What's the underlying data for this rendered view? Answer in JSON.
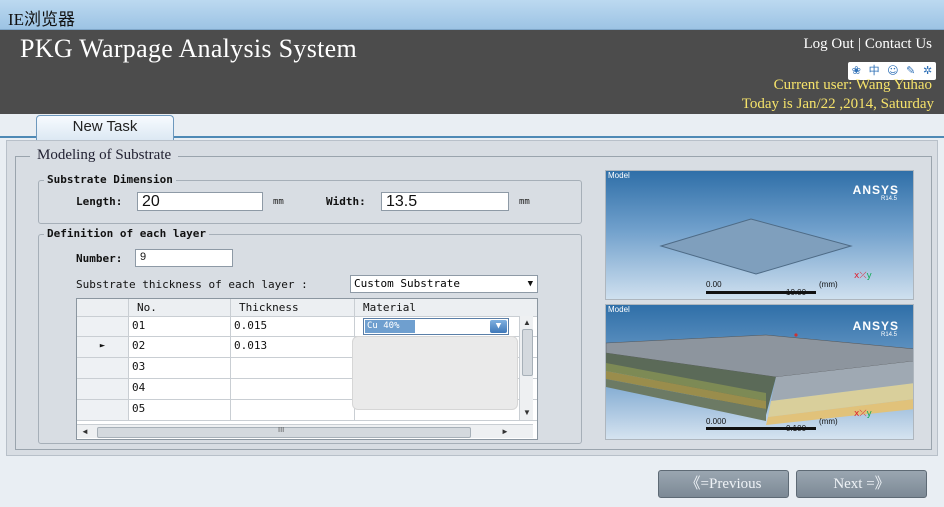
{
  "window": {
    "title": "IE浏览器"
  },
  "header": {
    "app_title": "PKG Warpage Analysis System",
    "logout": "Log Out",
    "separator": "|",
    "contact": "Contact Us",
    "current_user": "Current user:  Wang Yuhao",
    "today": "Today is Jan/22 ,2014,    Saturday",
    "icons": [
      "paw-icon",
      "chinese-char-icon",
      "smiley-icon",
      "pencil-icon",
      "gear-icon"
    ],
    "icon_glyphs": [
      "❀",
      "中",
      "☺",
      "✎",
      "✲"
    ]
  },
  "tabs": [
    {
      "label": "New Task"
    }
  ],
  "modeling": {
    "legend": "Modeling of Substrate",
    "dimension": {
      "legend": "Substrate Dimension",
      "length_label": "Length:",
      "length_value": "20",
      "length_unit": "mm",
      "width_label": "Width:",
      "width_value": "13.5",
      "width_unit": "mm"
    },
    "layers": {
      "legend": "Definition of each layer",
      "number_label": "Number:",
      "number_value": "9",
      "thickness_label": "Substrate thickness of each layer :",
      "thickness_option": "Custom Substrate",
      "columns": [
        "No.",
        "Thickness",
        "Material"
      ],
      "rows": [
        {
          "no": "01",
          "thickness": "0.015",
          "material": "Cu 40%"
        },
        {
          "no": "02",
          "thickness": "0.013",
          "material": ""
        },
        {
          "no": "03",
          "thickness": "",
          "material": ""
        },
        {
          "no": "04",
          "thickness": "",
          "material": ""
        },
        {
          "no": "05",
          "thickness": "",
          "material": ""
        }
      ],
      "current_row_marker": "►",
      "hscroll_grip": "III"
    }
  },
  "models": {
    "top": {
      "label": "Model",
      "brand": "ANSYS",
      "version": "R14.5",
      "scale_start": "0.00",
      "scale_end": "10.00",
      "unit": "(mm)"
    },
    "bottom": {
      "label": "Model",
      "brand": "ANSYS",
      "version": "R14.5",
      "scale_start": "0.000",
      "scale_end": "0.100",
      "unit": "(mm)"
    }
  },
  "nav": {
    "previous": "《=Previous",
    "next": "Next =》"
  },
  "colors": {
    "header_bg": "#4c4c4c",
    "highlight_text": "#f6e36a",
    "accent": "#4e89b5"
  }
}
